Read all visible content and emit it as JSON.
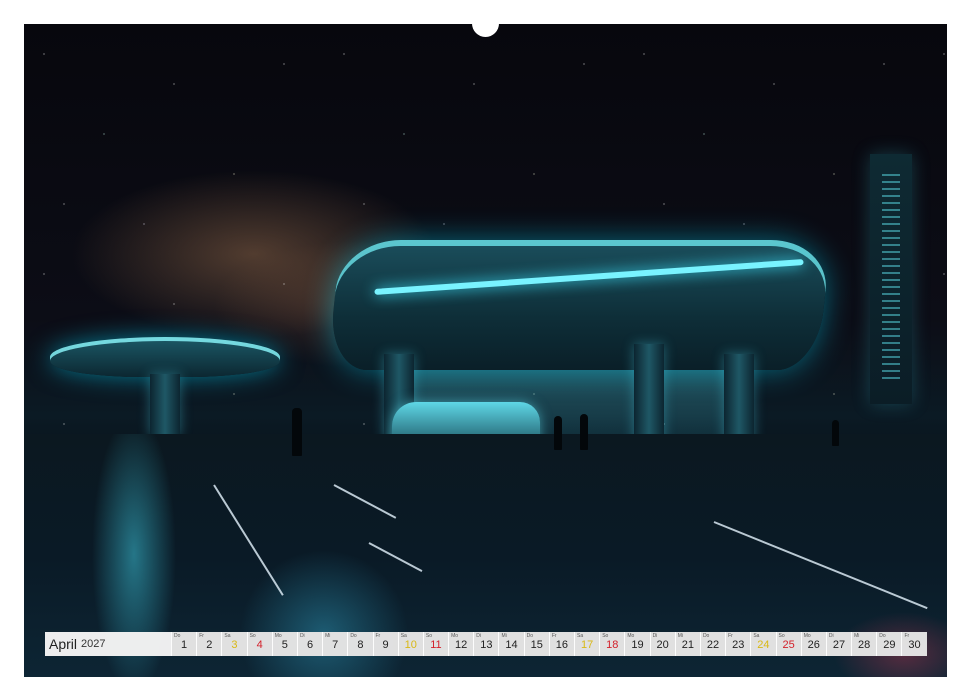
{
  "calendar": {
    "month": "April",
    "year": "2027",
    "days": [
      {
        "dow": "Do",
        "num": "1",
        "type": "weekday"
      },
      {
        "dow": "Fr",
        "num": "2",
        "type": "weekday"
      },
      {
        "dow": "Sa",
        "num": "3",
        "type": "sat"
      },
      {
        "dow": "So",
        "num": "4",
        "type": "sun"
      },
      {
        "dow": "Mo",
        "num": "5",
        "type": "weekday"
      },
      {
        "dow": "Di",
        "num": "6",
        "type": "weekday"
      },
      {
        "dow": "Mi",
        "num": "7",
        "type": "weekday"
      },
      {
        "dow": "Do",
        "num": "8",
        "type": "weekday"
      },
      {
        "dow": "Fr",
        "num": "9",
        "type": "weekday"
      },
      {
        "dow": "Sa",
        "num": "10",
        "type": "sat"
      },
      {
        "dow": "So",
        "num": "11",
        "type": "sun"
      },
      {
        "dow": "Mo",
        "num": "12",
        "type": "weekday"
      },
      {
        "dow": "Di",
        "num": "13",
        "type": "weekday"
      },
      {
        "dow": "Mi",
        "num": "14",
        "type": "weekday"
      },
      {
        "dow": "Do",
        "num": "15",
        "type": "weekday"
      },
      {
        "dow": "Fr",
        "num": "16",
        "type": "weekday"
      },
      {
        "dow": "Sa",
        "num": "17",
        "type": "sat"
      },
      {
        "dow": "So",
        "num": "18",
        "type": "sun"
      },
      {
        "dow": "Mo",
        "num": "19",
        "type": "weekday"
      },
      {
        "dow": "Di",
        "num": "20",
        "type": "weekday"
      },
      {
        "dow": "Mi",
        "num": "21",
        "type": "weekday"
      },
      {
        "dow": "Do",
        "num": "22",
        "type": "weekday"
      },
      {
        "dow": "Fr",
        "num": "23",
        "type": "weekday"
      },
      {
        "dow": "Sa",
        "num": "24",
        "type": "sat"
      },
      {
        "dow": "So",
        "num": "25",
        "type": "sun"
      },
      {
        "dow": "Mo",
        "num": "26",
        "type": "weekday"
      },
      {
        "dow": "Di",
        "num": "27",
        "type": "weekday"
      },
      {
        "dow": "Mi",
        "num": "28",
        "type": "weekday"
      },
      {
        "dow": "Do",
        "num": "29",
        "type": "weekday"
      },
      {
        "dow": "Fr",
        "num": "30",
        "type": "weekday"
      }
    ]
  },
  "colors": {
    "sunday": "#d3202a",
    "saturday": "#d9b814",
    "neon": "#79f3ff"
  }
}
